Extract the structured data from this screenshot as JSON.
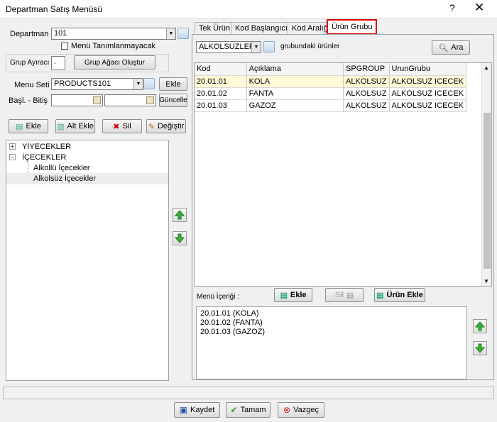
{
  "window": {
    "title": "Departman Satış Menüsü",
    "help": "?",
    "close": "✕"
  },
  "left": {
    "departman_label": "Departman",
    "departman_value": "101",
    "no_menu_label": "Menü Tanımlanmayacak",
    "grup_ayiraci_label": "Grup Ayıracı",
    "grup_ayiraci_value": ".",
    "grup_agaci_button": "Grup Ağacı Oluştur",
    "menu_seti_label": "Menu Seti",
    "menu_seti_value": "PRODUCTS101",
    "ekle_button": "Ekle",
    "basl_bitis_label": "Başl. - Bitiş",
    "guncelle_button": "Güncelle",
    "toolbar": {
      "ekle": "Ekle",
      "alt_ekle": "Alt Ekle",
      "sil": "Sil",
      "degistir": "Değiştir"
    },
    "tree": {
      "items": [
        {
          "label": "YİYECEKLER",
          "expander": "+"
        },
        {
          "label": "İÇECEKLER",
          "expander": "−"
        },
        {
          "label": "Alkollü İçecekler"
        },
        {
          "label": "Alkolsüz İçecekler"
        }
      ]
    }
  },
  "right": {
    "tabs": [
      "Tek Ürün",
      "Kod Başlangıcı",
      "Kod Aralığı",
      "Ürün Grubu"
    ],
    "active_tab": "Ürün Grubu",
    "group_value": "ALKOLSUZLER",
    "group_suffix": "grubundaki ürünler",
    "ara_button": "Ara",
    "table": {
      "headers": [
        "Kod",
        "Açıklama",
        "SPGROUP",
        "UrunGrubu"
      ],
      "rows": [
        [
          "20.01.01",
          "KOLA",
          "ALKOLSUZ",
          "ALKOLSUZ ICECEK"
        ],
        [
          "20.01.02",
          "FANTA",
          "ALKOLSUZ",
          "ALKOLSUZ ICECEK"
        ],
        [
          "20.01.03",
          "GAZOZ",
          "ALKOLSUZ",
          "ALKOLSUZ ICECEK"
        ]
      ]
    },
    "menu_icerigi_label": "Menü İçeriği :",
    "menu_ekle_button": "Ekle",
    "menu_sil_button": "Sil",
    "urun_ekle_button": "Ürün Ekle",
    "menu_items": [
      "20.01.01 (KOLA)",
      "20.01.02 (FANTA)",
      "20.01.03 (GAZOZ)"
    ]
  },
  "footer": {
    "kaydet": "Kaydet",
    "tamam": "Tamam",
    "vazgec": "Vazgeç"
  },
  "colors": {
    "highlight_row": "#fff9d6",
    "active_tab_border": "#e00000",
    "up_arrow": "#3cb03c"
  }
}
